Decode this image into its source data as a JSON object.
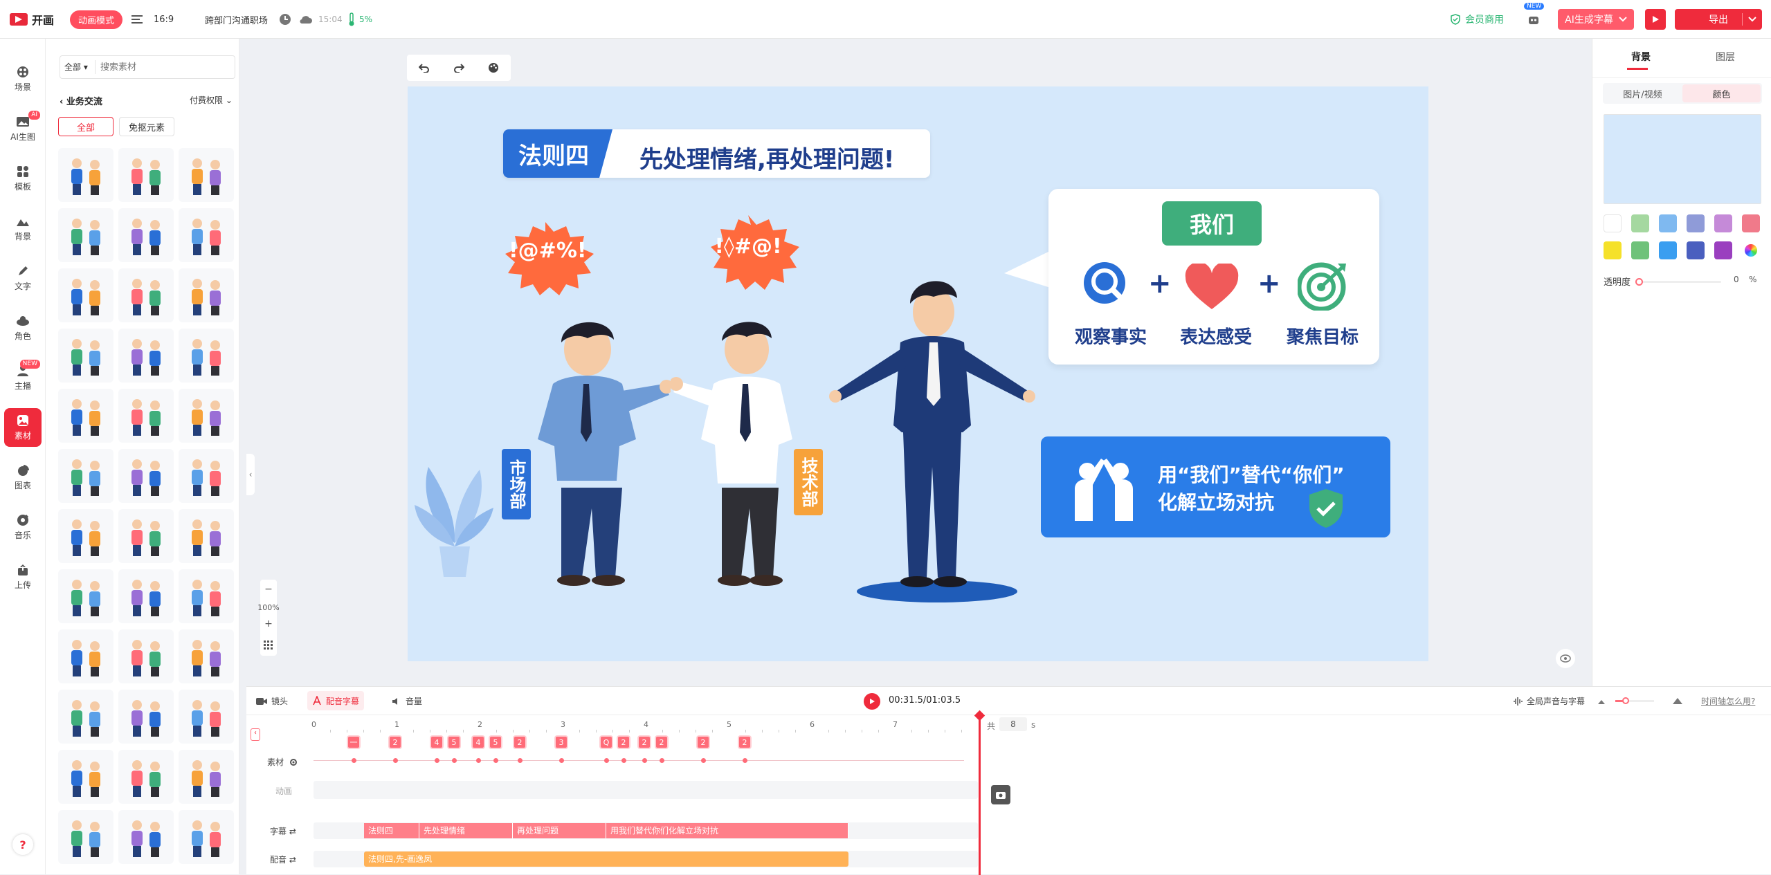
{
  "topbar": {
    "logo_text": "开画",
    "mode_badge": "动画模式",
    "ratio": "16:9",
    "doc_title": "跨部门沟通职场",
    "save_time": "15:04",
    "storage": "5%",
    "vip_label": "会员商用",
    "new_tag": "NEW",
    "ai_subtitle_label": "AI生成字幕",
    "export_label": "导出"
  },
  "rail": {
    "items": [
      {
        "label": "场景"
      },
      {
        "label": "AI生图",
        "badge": "AI"
      },
      {
        "label": "模板"
      },
      {
        "label": "背景"
      },
      {
        "label": "文字"
      },
      {
        "label": "角色"
      },
      {
        "label": "主播",
        "badge": "NEW"
      },
      {
        "label": "素材"
      },
      {
        "label": "图表"
      },
      {
        "label": "音乐"
      },
      {
        "label": "上传"
      }
    ],
    "help": "?"
  },
  "panel": {
    "filter_select": "全部",
    "search_placeholder": "搜索素材",
    "category": "业务交流",
    "permission": "付费权限",
    "chip_all": "全部",
    "chip_free": "免抠元素"
  },
  "canvas": {
    "zoom": "100%",
    "slide": {
      "title_tag": "法则四",
      "title_text": "先处理情绪,再处理问题!",
      "bubble_left": "!@#%!",
      "bubble_right": "!◊#@!",
      "label_market": "市场部",
      "label_tech": "技术部",
      "we_tag": "我们",
      "item1": "观察事实",
      "item2": "表达感受",
      "item3": "聚焦目标",
      "banner_line1": "用“我们”替代“你们”",
      "banner_line2": "化解立场对抗"
    }
  },
  "rpanel": {
    "tab_bg": "背景",
    "tab_layer": "图层",
    "sub_tab_media": "图片/视频",
    "sub_tab_color": "颜色",
    "selected_color": "#d5e8fb",
    "swatches": [
      "#ffffff",
      "#a5d8a0",
      "#7fb9f0",
      "#8f9bd8",
      "#c58ad8",
      "#f07a8a",
      "#f5e12a",
      "#6fc27a",
      "#3a9ef0",
      "#4a5fbf",
      "#9a3fbf",
      "rainbow"
    ],
    "opacity_label": "透明度",
    "opacity_value": "0",
    "opacity_unit": "%"
  },
  "timeline": {
    "tab_camera": "镜头",
    "tab_dub": "配音字幕",
    "tab_volume": "音量",
    "timecode": "00:31.5/01:03.5",
    "global_voice": "全局声音与字幕",
    "help_link": "时间轴怎么用?",
    "total_label": "共",
    "total_value": "8",
    "total_unit": "s",
    "ruler": [
      "0",
      "1",
      "2",
      "3",
      "4",
      "5",
      "6",
      "7"
    ],
    "track_asset": "素材",
    "track_anim": "动画",
    "track_subtitle": "字幕",
    "track_voice": "配音",
    "keyframes": [
      "一",
      "2",
      "4",
      "5",
      "4",
      "5",
      "2",
      "3",
      "Q",
      "2",
      "2",
      "2",
      "2",
      "2"
    ],
    "subtitles": [
      "法则四",
      "先处理情绪",
      "再处理问题",
      "用我们替代你们化解立场对抗"
    ],
    "voice_clip": "法则四,先-画逸凤"
  }
}
